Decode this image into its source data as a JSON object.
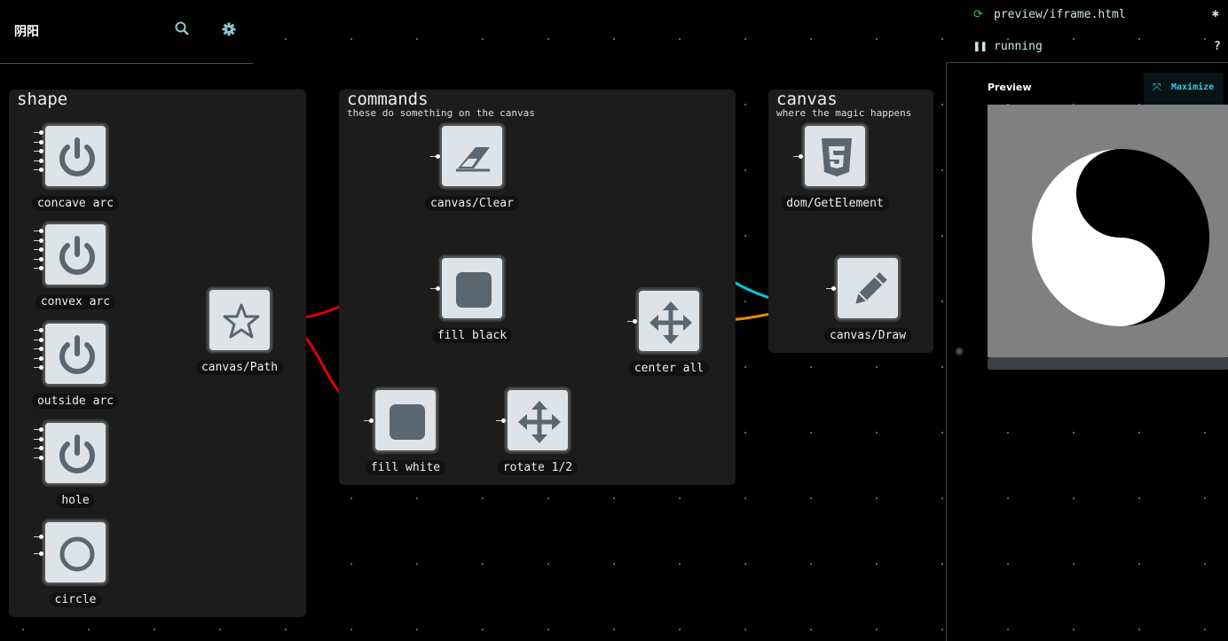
{
  "app": {
    "title": "阴阳",
    "search_icon": "search-icon",
    "settings_icon": "gear-icon"
  },
  "groups": [
    {
      "id": "shape",
      "title": "shape",
      "subtitle": ""
    },
    {
      "id": "commands",
      "title": "commands",
      "subtitle": "these do something on the canvas"
    },
    {
      "id": "canvas",
      "title": "canvas",
      "subtitle": "where the magic happens"
    }
  ],
  "nodes": [
    {
      "id": "concave",
      "label": "concave arc",
      "icon": "power-icon",
      "inputs": 5
    },
    {
      "id": "convex",
      "label": "convex arc",
      "icon": "power-icon",
      "inputs": 5
    },
    {
      "id": "outside",
      "label": "outside arc",
      "icon": "power-icon",
      "inputs": 5
    },
    {
      "id": "hole",
      "label": "hole",
      "icon": "power-icon",
      "inputs": 4
    },
    {
      "id": "circle",
      "label": "circle",
      "icon": "circle-icon",
      "inputs": 2
    },
    {
      "id": "path",
      "label": "canvas/Path",
      "icon": "star-icon",
      "inputs": 0
    },
    {
      "id": "clear",
      "label": "canvas/Clear",
      "icon": "eraser-icon",
      "inputs": 1
    },
    {
      "id": "fillblack",
      "label": "fill black",
      "icon": "square-icon",
      "inputs": 1
    },
    {
      "id": "fillwhite",
      "label": "fill white",
      "icon": "square-icon",
      "inputs": 1
    },
    {
      "id": "rotate",
      "label": "rotate 1/2",
      "icon": "move-icon",
      "inputs": 1
    },
    {
      "id": "center",
      "label": "center all",
      "icon": "move-icon",
      "inputs": 1
    },
    {
      "id": "getel",
      "label": "dom/GetElement",
      "icon": "html5-icon",
      "inputs": 1
    },
    {
      "id": "draw",
      "label": "canvas/Draw",
      "icon": "pencil-icon",
      "inputs": 1
    }
  ],
  "edges": [
    {
      "from": "concave",
      "to": "path",
      "color": "#e00000"
    },
    {
      "from": "convex",
      "to": "path",
      "color": "#e00000"
    },
    {
      "from": "outside",
      "to": "path",
      "color": "#e00000"
    },
    {
      "from": "hole",
      "to": "path",
      "color": "#e00000"
    },
    {
      "from": "circle",
      "to": "path",
      "color": "#e00000"
    },
    {
      "from": "path",
      "to": "fillblack",
      "color": "#e00000"
    },
    {
      "from": "path",
      "to": "fillwhite",
      "color": "#e00000"
    },
    {
      "from": "fillblack",
      "to": "center",
      "color": "#e88a00"
    },
    {
      "from": "fillwhite",
      "to": "rotate",
      "color": "#e88a00"
    },
    {
      "from": "rotate",
      "to": "center",
      "color": "#e88a00"
    },
    {
      "from": "center",
      "to": "draw",
      "color": "#e88a00"
    },
    {
      "from": "clear",
      "to": "draw",
      "color": "#00c8dc"
    },
    {
      "from": "getel",
      "to": "draw",
      "color": "#00d040"
    }
  ],
  "panel": {
    "file": "preview/iframe.html",
    "status": "running",
    "preview_title": "Preview",
    "maximize_label": "Maximize",
    "refresh_icon": "refresh-icon",
    "pause_icon": "pause-icon",
    "bug_icon": "bug-icon",
    "help_label": "?",
    "eye_icon": "eye-icon"
  }
}
